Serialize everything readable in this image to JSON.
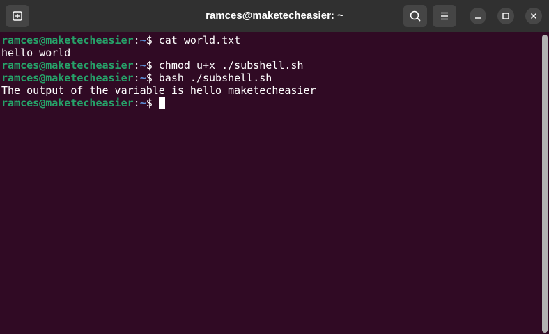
{
  "window": {
    "title": "ramces@maketecheasier: ~"
  },
  "titlebar": {
    "icons": [
      "new-tab-icon",
      "search-icon",
      "hamburger-menu-icon",
      "minimize-icon",
      "maximize-icon",
      "close-icon"
    ]
  },
  "terminal": {
    "prompt_user": "ramces@maketecheasier",
    "prompt_colon": ":",
    "prompt_path": "~",
    "prompt_symbol": "$ ",
    "lines": [
      {
        "type": "command",
        "text": "cat world.txt"
      },
      {
        "type": "output",
        "text": "hello world"
      },
      {
        "type": "command",
        "text": "chmod u+x ./subshell.sh"
      },
      {
        "type": "command",
        "text": "bash ./subshell.sh"
      },
      {
        "type": "output",
        "text": "The output of the variable is hello maketecheasier"
      },
      {
        "type": "command",
        "text": ""
      }
    ],
    "colors": {
      "background": "#300a24",
      "user": "#26a269",
      "path": "#5d8fd6",
      "text": "#ffffff"
    }
  }
}
